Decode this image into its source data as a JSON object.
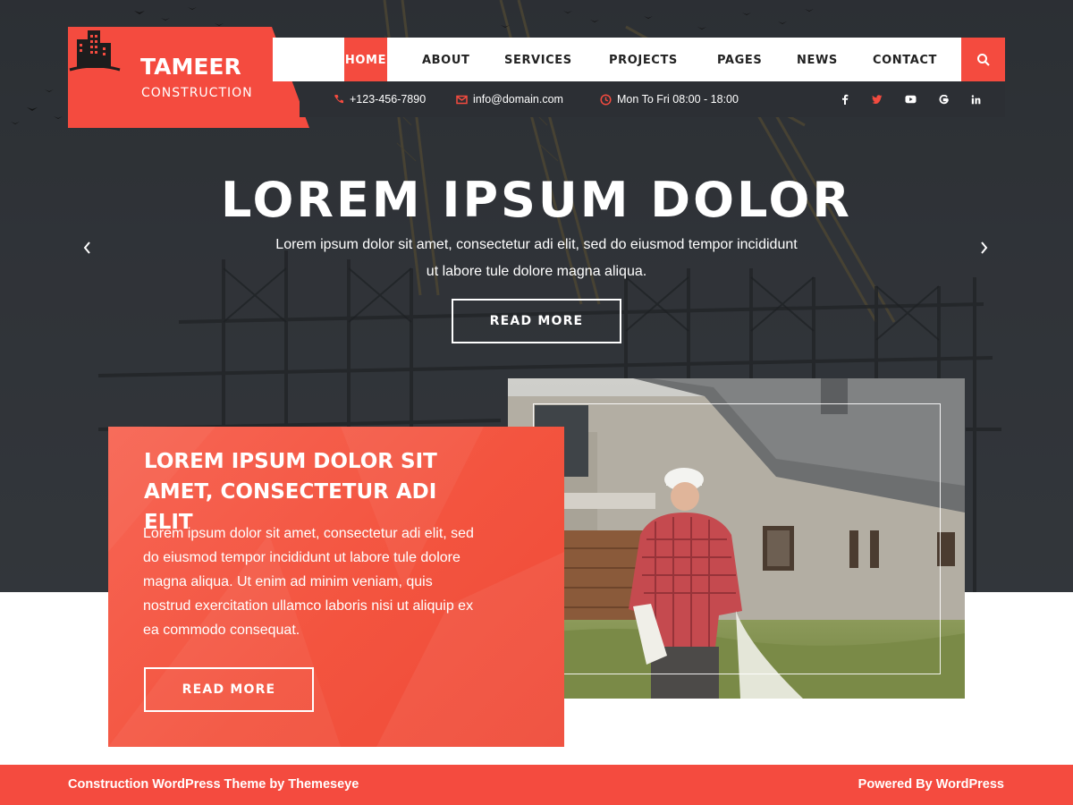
{
  "brand": {
    "name": "TAMEER",
    "tagline": "CONSTRUCTION",
    "accent_color": "#f44b3f",
    "dark_color": "#2c2f34"
  },
  "nav": {
    "items": [
      {
        "label": "HOME",
        "active": true
      },
      {
        "label": "ABOUT"
      },
      {
        "label": "SERVICES"
      },
      {
        "label": "PROJECTS"
      },
      {
        "label": "PAGES"
      },
      {
        "label": "NEWS"
      },
      {
        "label": "CONTACT"
      }
    ],
    "search_icon": "search-icon"
  },
  "topbar": {
    "phone": "+123-456-7890",
    "email": "info@domain.com",
    "hours": "Mon To Fri 08:00 - 18:00",
    "social": [
      "facebook-icon",
      "twitter-icon",
      "youtube-icon",
      "google-icon",
      "linkedin-icon"
    ]
  },
  "hero": {
    "title": "LOREM IPSUM DOLOR",
    "text": "Lorem ipsum dolor sit amet, consectetur adi elit, sed do eiusmod tempor incididunt ut labore tule dolore magna aliqua.",
    "button": "READ MORE",
    "prev_icon": "chevron-left-icon",
    "next_icon": "chevron-right-icon"
  },
  "about": {
    "title": "LOREM IPSUM DOLOR SIT AMET, CONSECTETUR ADI ELIT",
    "text": "Lorem ipsum dolor sit amet, consectetur adi elit, sed do eiusmod tempor incididunt ut labore tule dolore magna aliqua. Ut enim ad minim veniam, quis nostrud exercitation ullamco laboris nisi ut aliquip ex ea commodo consequat.",
    "button": "READ MORE"
  },
  "footer": {
    "left": "Construction WordPress Theme by Themeseye",
    "right": "Powered By WordPress"
  }
}
